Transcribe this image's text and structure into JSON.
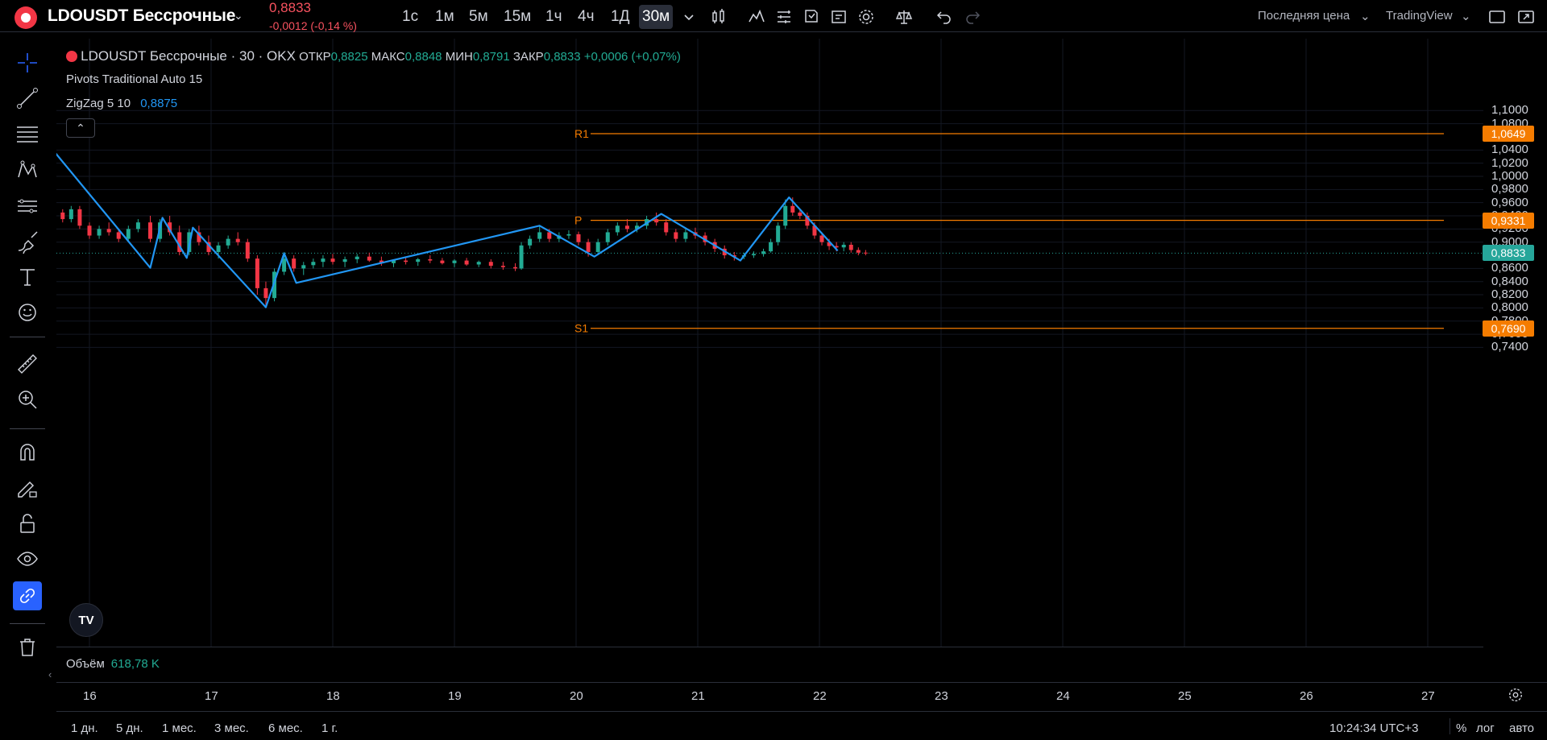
{
  "header": {
    "symbol": "LDOUSDT Бессрочные",
    "last_price": "0,8833",
    "change": "-0,0012 (-0,14 %)",
    "intervals": [
      {
        "label": "1с"
      },
      {
        "label": "1м"
      },
      {
        "label": "5м"
      },
      {
        "label": "15м"
      },
      {
        "label": "1ч"
      },
      {
        "label": "4ч"
      },
      {
        "label": "1Д"
      },
      {
        "label": "30м",
        "active": true
      }
    ],
    "price_type": "Последняя цена",
    "theme": "TradingView",
    "icons": [
      "chevron-down-icon",
      "bar-style-icon",
      "indicators-icon",
      "templates-icon",
      "alert-icon",
      "replay-icon",
      "settings-icon",
      "compare-icon",
      "undo-icon",
      "redo-icon",
      "layout-icon",
      "fullscreen-icon"
    ]
  },
  "legend": {
    "title": "LDOUSDT Бессрочные · 30 · OKX",
    "open_label": "ОТКР",
    "open": "0,8825",
    "high_label": "МАКС",
    "high": "0,8848",
    "low_label": "МИН",
    "low": "0,8791",
    "close_label": "ЗАКР",
    "close": "0,8833",
    "change": "+0,0006 (+0,07%)",
    "pivots": "Pivots Traditional Auto 15",
    "zigzag": "ZigZag 5 10",
    "zigzag_value": "0,8875",
    "collapse": "⌃"
  },
  "pivots": [
    {
      "name": "R1",
      "value": 1.0649,
      "label": "1,0649"
    },
    {
      "name": "P",
      "value": 0.9331,
      "label": "0,9331"
    },
    {
      "name": "S1",
      "value": 0.769,
      "label": "0,7690"
    }
  ],
  "price_axis": {
    "ticks": [
      "1,1000",
      "1,0800",
      "1,0400",
      "1,0200",
      "1,0000",
      "0,9800",
      "0,9600",
      "0,9400",
      "0,9200",
      "0,9000",
      "0,8600",
      "0,8400",
      "0,8200",
      "0,8000",
      "0,7800",
      "0,7600",
      "0,7400"
    ],
    "last_tag": "0,8833"
  },
  "volume": {
    "label": "Объём",
    "value": "618,78 K"
  },
  "time_axis": {
    "ticks": [
      "16",
      "17",
      "18",
      "19",
      "20",
      "21",
      "22",
      "23",
      "24",
      "25",
      "26",
      "27"
    ]
  },
  "bottom": {
    "ranges": [
      "1 дн.",
      "5 дн.",
      "1 мес.",
      "3 мес.",
      "6 мес.",
      "1 г."
    ],
    "clock": "10:24:34 UTC+3",
    "percent": "%",
    "log": "лог",
    "auto": "авто"
  },
  "left_tools": [
    "crosshair-icon",
    "trendline-icon",
    "fib-icon",
    "pattern-icon",
    "forecast-icon",
    "brush-icon",
    "text-icon",
    "emoji-icon",
    "ruler-icon",
    "zoom-icon",
    "magnet-icon",
    "lock-drawing-icon",
    "lock-icon",
    "eye-icon",
    "link-icon",
    "trash-icon"
  ],
  "chart_data": {
    "type": "candlestick",
    "y_range": [
      0.72,
      1.1
    ],
    "colors": {
      "up": "#22ab94",
      "down": "#f23645",
      "zigzag": "#2196f3",
      "pivot": "#f57c00",
      "last_price": "#26a69a"
    },
    "zigzag": [
      [
        15.7,
        1.04
      ],
      [
        16.5,
        0.861
      ],
      [
        16.6,
        0.937
      ],
      [
        16.8,
        0.876
      ],
      [
        16.85,
        0.922
      ],
      [
        17.45,
        0.801
      ],
      [
        17.6,
        0.883
      ],
      [
        17.7,
        0.838
      ],
      [
        19.7,
        0.925
      ],
      [
        20.15,
        0.878
      ],
      [
        20.7,
        0.943
      ],
      [
        21.35,
        0.872
      ],
      [
        21.75,
        0.968
      ],
      [
        22.15,
        0.887
      ]
    ],
    "candles_ohlc": [
      [
        15.7,
        0.96,
        0.975,
        0.94,
        0.945
      ],
      [
        15.78,
        0.945,
        0.95,
        0.93,
        0.935
      ],
      [
        15.85,
        0.935,
        0.955,
        0.93,
        0.95
      ],
      [
        15.92,
        0.95,
        0.955,
        0.92,
        0.925
      ],
      [
        16.0,
        0.925,
        0.93,
        0.905,
        0.91
      ],
      [
        16.08,
        0.91,
        0.925,
        0.905,
        0.92
      ],
      [
        16.16,
        0.92,
        0.93,
        0.91,
        0.915
      ],
      [
        16.24,
        0.915,
        0.92,
        0.9,
        0.905
      ],
      [
        16.32,
        0.905,
        0.925,
        0.9,
        0.92
      ],
      [
        16.4,
        0.92,
        0.935,
        0.915,
        0.93
      ],
      [
        16.5,
        0.93,
        0.94,
        0.9,
        0.905
      ],
      [
        16.58,
        0.905,
        0.935,
        0.9,
        0.93
      ],
      [
        16.66,
        0.93,
        0.94,
        0.91,
        0.915
      ],
      [
        16.74,
        0.915,
        0.925,
        0.88,
        0.885
      ],
      [
        16.82,
        0.885,
        0.92,
        0.88,
        0.915
      ],
      [
        16.9,
        0.915,
        0.925,
        0.895,
        0.9
      ],
      [
        16.98,
        0.9,
        0.91,
        0.88,
        0.885
      ],
      [
        17.06,
        0.885,
        0.9,
        0.875,
        0.895
      ],
      [
        17.14,
        0.895,
        0.91,
        0.89,
        0.905
      ],
      [
        17.22,
        0.905,
        0.915,
        0.895,
        0.9
      ],
      [
        17.3,
        0.9,
        0.905,
        0.87,
        0.875
      ],
      [
        17.38,
        0.875,
        0.88,
        0.82,
        0.83
      ],
      [
        17.45,
        0.83,
        0.84,
        0.8,
        0.815
      ],
      [
        17.52,
        0.815,
        0.86,
        0.81,
        0.855
      ],
      [
        17.6,
        0.855,
        0.885,
        0.85,
        0.875
      ],
      [
        17.68,
        0.875,
        0.88,
        0.855,
        0.86
      ],
      [
        17.76,
        0.86,
        0.87,
        0.85,
        0.865
      ],
      [
        17.84,
        0.865,
        0.875,
        0.86,
        0.87
      ],
      [
        17.92,
        0.87,
        0.88,
        0.862,
        0.875
      ],
      [
        18.0,
        0.875,
        0.882,
        0.866,
        0.87
      ],
      [
        18.1,
        0.87,
        0.878,
        0.862,
        0.874
      ],
      [
        18.2,
        0.874,
        0.882,
        0.868,
        0.878
      ],
      [
        18.3,
        0.878,
        0.884,
        0.87,
        0.872
      ],
      [
        18.4,
        0.872,
        0.878,
        0.864,
        0.868
      ],
      [
        18.5,
        0.868,
        0.874,
        0.862,
        0.872
      ],
      [
        18.6,
        0.872,
        0.878,
        0.866,
        0.87
      ],
      [
        18.7,
        0.87,
        0.876,
        0.864,
        0.874
      ],
      [
        18.8,
        0.874,
        0.88,
        0.868,
        0.872
      ],
      [
        18.9,
        0.872,
        0.876,
        0.866,
        0.868
      ],
      [
        19.0,
        0.868,
        0.874,
        0.862,
        0.872
      ],
      [
        19.1,
        0.872,
        0.876,
        0.864,
        0.866
      ],
      [
        19.2,
        0.866,
        0.872,
        0.862,
        0.87
      ],
      [
        19.3,
        0.87,
        0.874,
        0.86,
        0.864
      ],
      [
        19.4,
        0.864,
        0.87,
        0.858,
        0.862
      ],
      [
        19.5,
        0.862,
        0.868,
        0.856,
        0.86
      ],
      [
        19.55,
        0.86,
        0.9,
        0.858,
        0.895
      ],
      [
        19.62,
        0.895,
        0.91,
        0.89,
        0.905
      ],
      [
        19.7,
        0.905,
        0.925,
        0.9,
        0.915
      ],
      [
        19.78,
        0.915,
        0.92,
        0.9,
        0.905
      ],
      [
        19.86,
        0.905,
        0.915,
        0.9,
        0.91
      ],
      [
        19.94,
        0.91,
        0.918,
        0.905,
        0.912
      ],
      [
        20.02,
        0.912,
        0.916,
        0.895,
        0.9
      ],
      [
        20.1,
        0.9,
        0.905,
        0.878,
        0.885
      ],
      [
        20.18,
        0.885,
        0.905,
        0.88,
        0.9
      ],
      [
        20.26,
        0.9,
        0.92,
        0.895,
        0.915
      ],
      [
        20.34,
        0.915,
        0.93,
        0.91,
        0.925
      ],
      [
        20.42,
        0.925,
        0.935,
        0.915,
        0.92
      ],
      [
        20.5,
        0.92,
        0.93,
        0.915,
        0.925
      ],
      [
        20.58,
        0.925,
        0.94,
        0.92,
        0.935
      ],
      [
        20.66,
        0.935,
        0.945,
        0.925,
        0.93
      ],
      [
        20.74,
        0.93,
        0.935,
        0.91,
        0.915
      ],
      [
        20.82,
        0.915,
        0.92,
        0.9,
        0.905
      ],
      [
        20.9,
        0.905,
        0.92,
        0.9,
        0.915
      ],
      [
        20.98,
        0.915,
        0.922,
        0.905,
        0.91
      ],
      [
        21.06,
        0.91,
        0.915,
        0.895,
        0.9
      ],
      [
        21.14,
        0.9,
        0.905,
        0.885,
        0.89
      ],
      [
        21.22,
        0.89,
        0.895,
        0.875,
        0.88
      ],
      [
        21.3,
        0.88,
        0.885,
        0.872,
        0.878
      ],
      [
        21.38,
        0.878,
        0.884,
        0.874,
        0.88
      ],
      [
        21.46,
        0.88,
        0.886,
        0.876,
        0.882
      ],
      [
        21.54,
        0.882,
        0.89,
        0.878,
        0.886
      ],
      [
        21.6,
        0.886,
        0.905,
        0.884,
        0.9
      ],
      [
        21.66,
        0.9,
        0.93,
        0.895,
        0.925
      ],
      [
        21.72,
        0.925,
        0.965,
        0.92,
        0.955
      ],
      [
        21.78,
        0.955,
        0.968,
        0.94,
        0.945
      ],
      [
        21.84,
        0.945,
        0.95,
        0.935,
        0.94
      ],
      [
        21.9,
        0.94,
        0.945,
        0.92,
        0.925
      ],
      [
        21.96,
        0.925,
        0.93,
        0.905,
        0.91
      ],
      [
        22.02,
        0.91,
        0.915,
        0.895,
        0.9
      ],
      [
        22.08,
        0.9,
        0.905,
        0.888,
        0.894
      ],
      [
        22.14,
        0.894,
        0.9,
        0.886,
        0.892
      ],
      [
        22.2,
        0.892,
        0.9,
        0.886,
        0.896
      ],
      [
        22.26,
        0.896,
        0.9,
        0.884,
        0.888
      ],
      [
        22.32,
        0.888,
        0.892,
        0.88,
        0.884
      ],
      [
        22.38,
        0.884,
        0.888,
        0.88,
        0.8833
      ]
    ]
  }
}
